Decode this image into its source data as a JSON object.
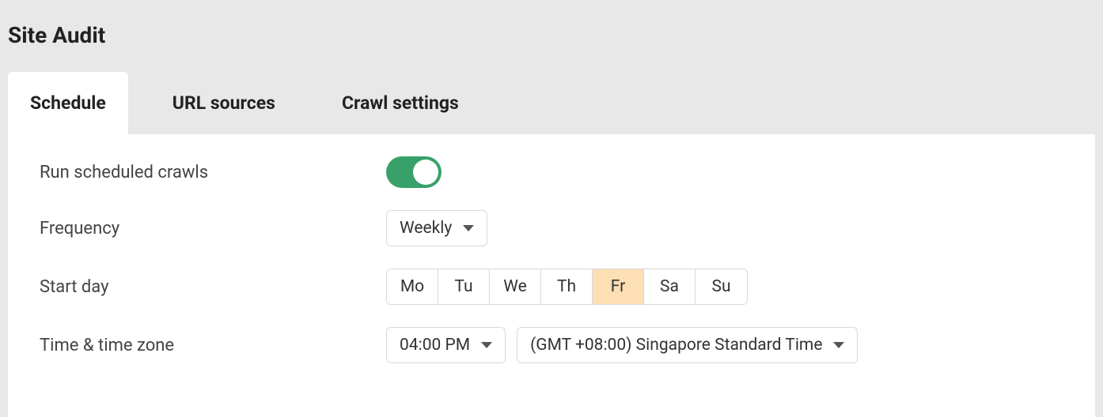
{
  "page_title": "Site Audit",
  "tabs": [
    {
      "label": "Schedule",
      "active": true
    },
    {
      "label": "URL sources",
      "active": false
    },
    {
      "label": "Crawl settings",
      "active": false
    }
  ],
  "form": {
    "run_crawls": {
      "label": "Run scheduled crawls",
      "enabled": true,
      "on_color": "#38a169"
    },
    "frequency": {
      "label": "Frequency",
      "value": "Weekly"
    },
    "start_day": {
      "label": "Start day",
      "days": [
        {
          "abbr": "Mo",
          "selected": false
        },
        {
          "abbr": "Tu",
          "selected": false
        },
        {
          "abbr": "We",
          "selected": false
        },
        {
          "abbr": "Th",
          "selected": false
        },
        {
          "abbr": "Fr",
          "selected": true
        },
        {
          "abbr": "Sa",
          "selected": false
        },
        {
          "abbr": "Su",
          "selected": false
        }
      ]
    },
    "time_zone": {
      "label": "Time & time zone",
      "time": "04:00 PM",
      "zone": "(GMT +08:00) Singapore Standard Time"
    }
  }
}
